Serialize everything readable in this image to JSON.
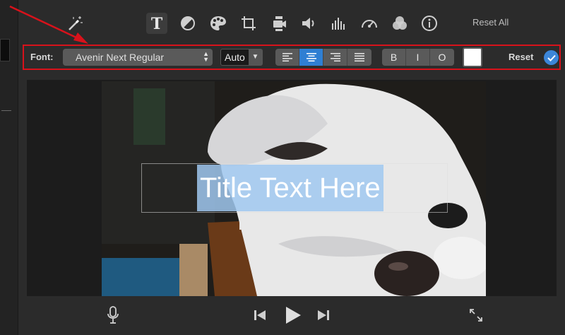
{
  "toolbar": {
    "tools": [
      "magic-wand",
      "title-text",
      "color-balance",
      "color-palette",
      "crop",
      "stabilization",
      "volume",
      "equalizer",
      "speed",
      "filter",
      "info"
    ],
    "reset_all_label": "Reset All"
  },
  "settings": {
    "font_label": "Font:",
    "font_value": "Avenir Next Regular",
    "size_value": "Auto",
    "alignment": [
      "left",
      "center",
      "right",
      "justify"
    ],
    "selected_alignment": "center",
    "style_bold": "B",
    "style_italic": "I",
    "style_outline": "O",
    "text_color": "#ffffff",
    "reset_label": "Reset",
    "accent": "#2f7fd3",
    "highlight_border": "#d8121b"
  },
  "viewer": {
    "title_text": "Title Text Here"
  },
  "controls": [
    "microphone",
    "skip-back",
    "play",
    "skip-forward",
    "fullscreen"
  ]
}
